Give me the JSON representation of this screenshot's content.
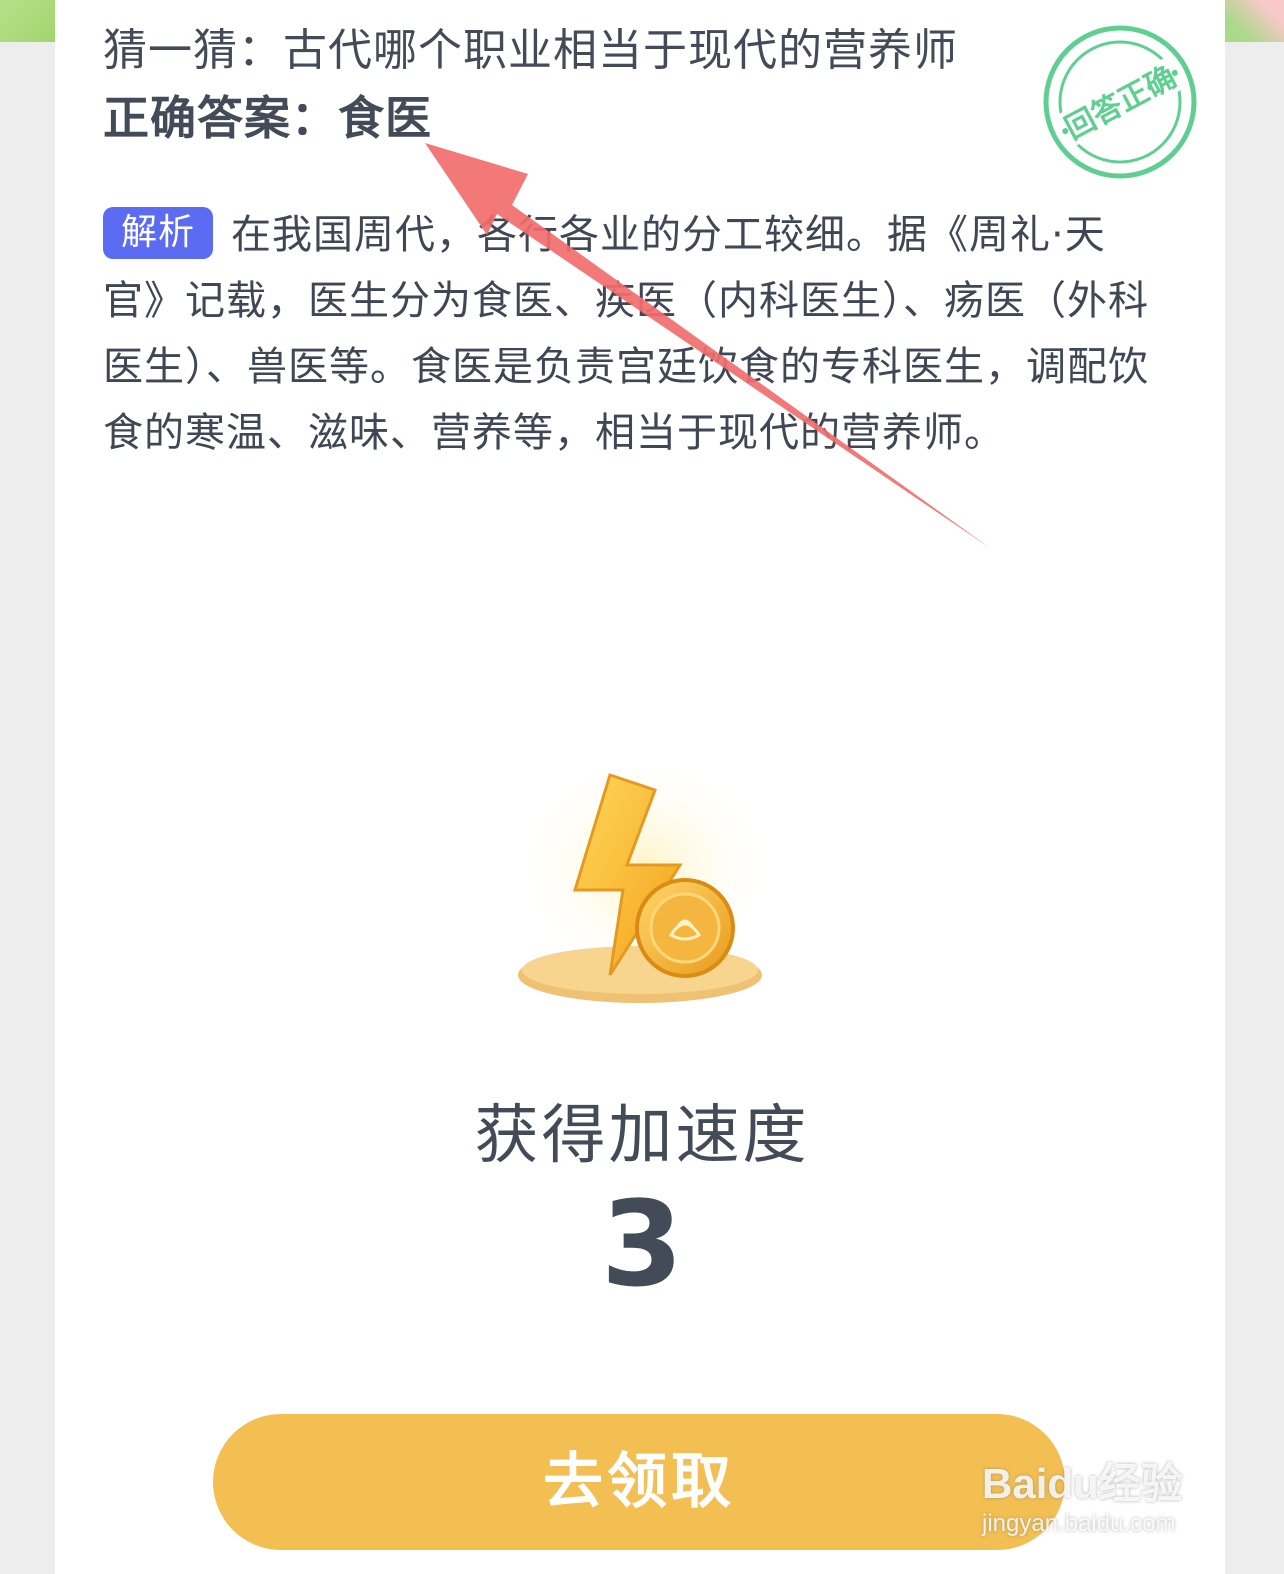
{
  "quiz": {
    "question": "猜一猜：古代哪个职业相当于现代的营养师",
    "answer": "正确答案：食医",
    "stamp_text": "回答正确",
    "analysis_badge": "解析",
    "analysis_text": "在我国周代，各行各业的分工较细。据《周礼·天官》记载，医生分为食医、疾医（内科医生）、疡医（外科医生）、兽医等。食医是负责宫廷饮食的专科医生，调配饮食的寒温、滋味、营养等，相当于现代的营养师。"
  },
  "reward": {
    "icon": "lightning-coin-icon",
    "label": "获得加速度",
    "value": "3"
  },
  "claim_button": {
    "label": "去领取"
  },
  "watermark": {
    "logo": "Baidu经验",
    "url": "jingyan.baidu.com"
  },
  "colors": {
    "badge": "#5b6cf2",
    "button": "#f3bf52",
    "stamp": "#5fcf91",
    "arrow": "#f26d6d",
    "text": "#444b58"
  }
}
